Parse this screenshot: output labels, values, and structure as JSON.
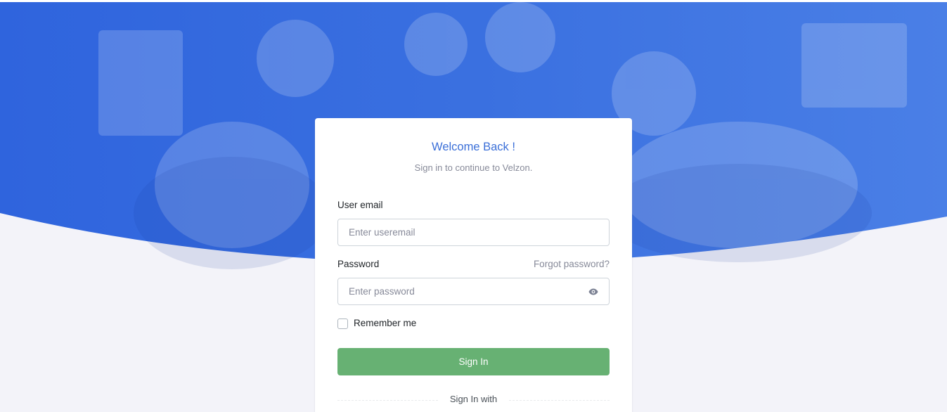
{
  "login": {
    "title": "Welcome Back !",
    "subtitle": "Sign in to continue to Velzon.",
    "email_label": "User email",
    "email_placeholder": "Enter useremail",
    "email_value": "",
    "password_label": "Password",
    "forgot_link": "Forgot password?",
    "password_placeholder": "Enter password",
    "password_value": "",
    "remember_label": "Remember me",
    "remember_checked": false,
    "submit_label": "Sign In",
    "social_divider": "Sign In with"
  },
  "icons": {
    "password_toggle": "eye-icon"
  },
  "colors": {
    "hero_blue": "#3b6fdf",
    "title_blue": "#3b6fd8",
    "button_green": "#67b173",
    "page_background": "#f3f3f9",
    "muted_text": "#878a99"
  }
}
